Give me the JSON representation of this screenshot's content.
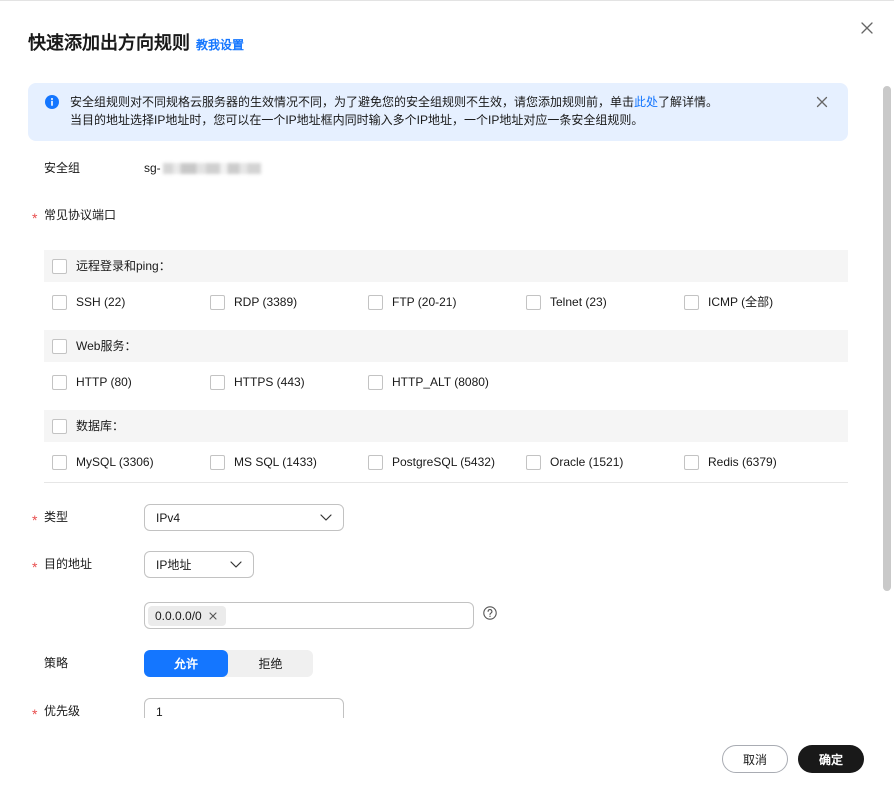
{
  "dialog": {
    "title": "快速添加出方向规则",
    "help_link": "教我设置"
  },
  "notice": {
    "line1_prefix": "安全组规则对不同规格云服务器的生效情况不同，为了避免您的安全组规则不生效，请您添加规则前，单击",
    "line1_link": "此处",
    "line1_suffix": "了解详情。",
    "line2": "当目的地址选择IP地址时，您可以在一个IP地址框内同时输入多个IP地址，一个IP地址对应一条安全组规则。"
  },
  "form": {
    "required_mark": "*"
  },
  "security_group": {
    "label": "安全组",
    "value": "sg-"
  },
  "ports": {
    "label": "常见协议端口",
    "groups": [
      {
        "title": "远程登录和ping：",
        "checked": false,
        "options": [
          {
            "label": "SSH (22)",
            "checked": false
          },
          {
            "label": "RDP (3389)",
            "checked": false
          },
          {
            "label": "FTP (20-21)",
            "checked": false
          },
          {
            "label": "Telnet (23)",
            "checked": false
          },
          {
            "label": "ICMP (全部)",
            "checked": false
          }
        ]
      },
      {
        "title": "Web服务：",
        "checked": false,
        "options": [
          {
            "label": "HTTP (80)",
            "checked": false
          },
          {
            "label": "HTTPS (443)",
            "checked": false
          },
          {
            "label": "HTTP_ALT (8080)",
            "checked": false
          }
        ]
      },
      {
        "title": "数据库：",
        "checked": false,
        "options": [
          {
            "label": "MySQL (3306)",
            "checked": false
          },
          {
            "label": "MS SQL (1433)",
            "checked": false
          },
          {
            "label": "PostgreSQL (5432)",
            "checked": false
          },
          {
            "label": "Oracle (1521)",
            "checked": false
          },
          {
            "label": "Redis (6379)",
            "checked": false
          }
        ]
      }
    ]
  },
  "type": {
    "label": "类型",
    "value": "IPv4"
  },
  "destination": {
    "label": "目的地址",
    "mode": "IP地址",
    "tags": [
      "0.0.0.0/0"
    ]
  },
  "policy": {
    "label": "策略",
    "options": [
      "允许",
      "拒绝"
    ],
    "selected": "允许"
  },
  "priority": {
    "label": "优先级",
    "value": "1"
  },
  "footer": {
    "cancel": "取消",
    "confirm": "确定"
  },
  "icons": {
    "dialog_close": "close-icon",
    "notice": "info-icon",
    "notice_close": "close-icon",
    "select": "chevron-down-icon",
    "tag_remove": "close-icon",
    "help": "help-icon"
  },
  "colors": {
    "primary": "#1476ff",
    "notice_bg": "#e6f0ff",
    "required": "#e84e4e",
    "confirm_bg": "#191919",
    "group_bg": "#f5f5f5",
    "text": "#191919"
  }
}
